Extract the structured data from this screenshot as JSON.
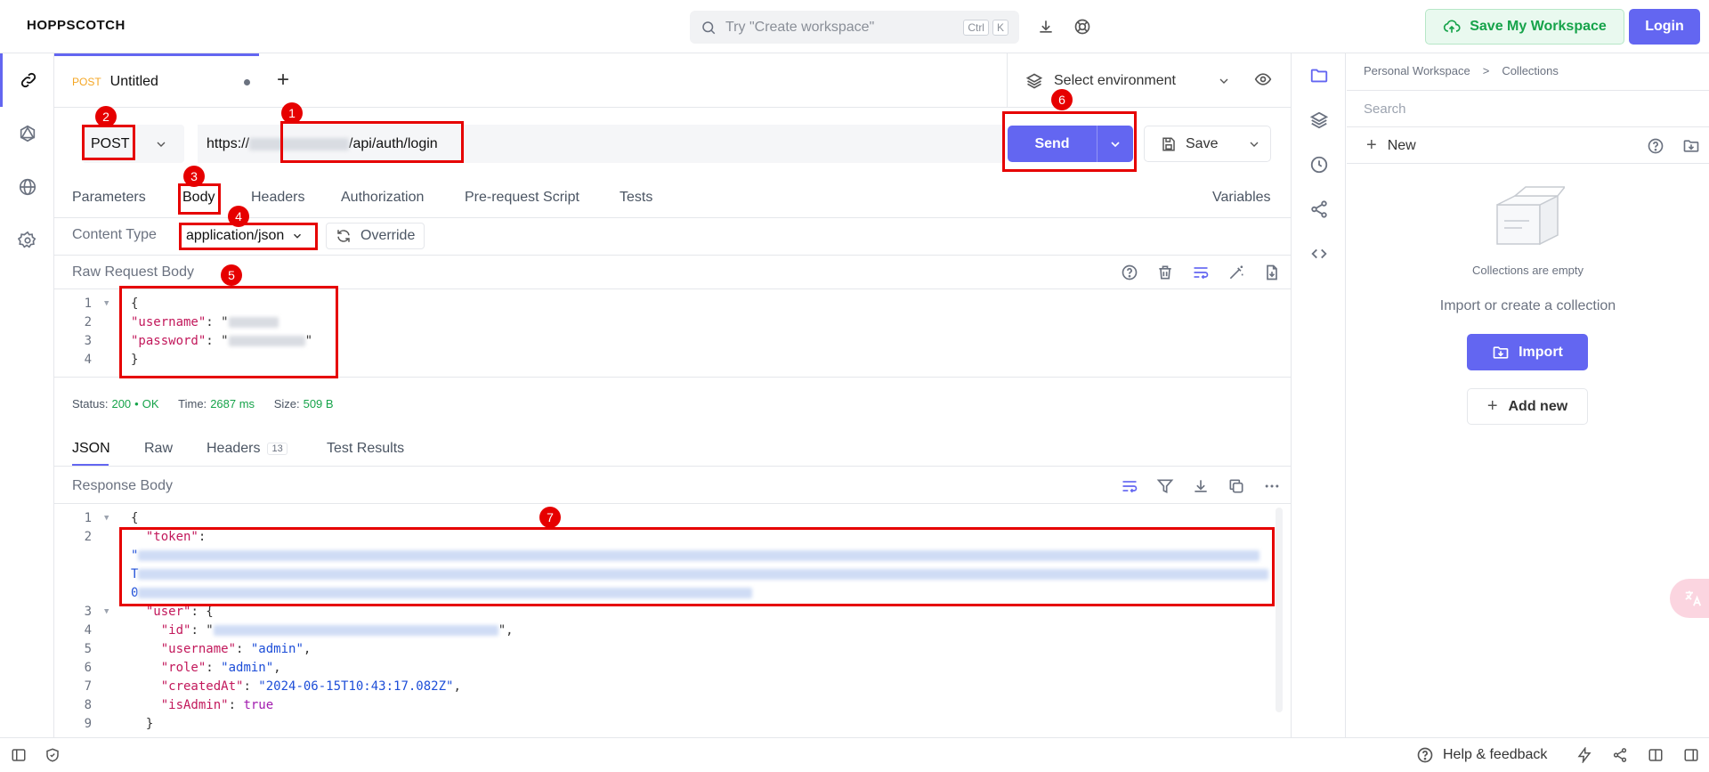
{
  "header": {
    "logo": "HOPPSCOTCH",
    "search_placeholder": "Try \"Create workspace\"",
    "kbd_ctrl": "Ctrl",
    "kbd_k": "K",
    "save_workspace_label": "Save My Workspace",
    "login_label": "Login"
  },
  "tab": {
    "method": "POST",
    "name": "Untitled",
    "add_label": "+"
  },
  "environment": {
    "label": "Select environment"
  },
  "request": {
    "method": "POST",
    "url_prefix": "https://",
    "url_suffix": "/api/auth/login",
    "send_label": "Send",
    "save_label": "Save"
  },
  "request_tabs": [
    "Parameters",
    "Body",
    "Headers",
    "Authorization",
    "Pre-request Script",
    "Tests"
  ],
  "variables_label": "Variables",
  "content_type": {
    "label": "Content Type",
    "value": "application/json",
    "override_label": "Override"
  },
  "raw_body": {
    "label": "Raw Request Body",
    "lines": [
      {
        "n": "1",
        "text": "{"
      },
      {
        "n": "2",
        "key": "\"username\"",
        "colon": ": \"",
        "blurred": true
      },
      {
        "n": "3",
        "key": "\"password\"",
        "colon": ": \"",
        "blurred": true,
        "tail": "\""
      },
      {
        "n": "4",
        "text": "}"
      }
    ]
  },
  "status": {
    "status_label": "Status:",
    "status_code": "200",
    "status_dot": "•",
    "status_text": "OK",
    "time_label": "Time:",
    "time_value": "2687 ms",
    "size_label": "Size:",
    "size_value": "509 B"
  },
  "response_tabs": {
    "json": "JSON",
    "raw": "Raw",
    "headers": "Headers",
    "headers_count": "13",
    "test_results": "Test Results"
  },
  "response_body": {
    "label": "Response Body",
    "lines": [
      {
        "n": "1",
        "text": "{"
      },
      {
        "n": "2",
        "key": "\"token\"",
        "colon": ":"
      },
      {
        "n": "",
        "text": "\"",
        "blurred": true
      },
      {
        "n": "",
        "text": "T",
        "blurred": true
      },
      {
        "n": "",
        "text": "0",
        "blurred": true
      },
      {
        "n": "3",
        "key": "\"user\"",
        "colon": ": {"
      },
      {
        "n": "4",
        "key": "\"id\"",
        "colon": ": \"",
        "blurred": true,
        "tail": "\","
      },
      {
        "n": "5",
        "key": "\"username\"",
        "colon": ": ",
        "value": "\"admin\"",
        "tail": ","
      },
      {
        "n": "6",
        "key": "\"role\"",
        "colon": ": ",
        "value": "\"admin\"",
        "tail": ","
      },
      {
        "n": "7",
        "key": "\"createdAt\"",
        "colon": ": ",
        "value": "\"2024-06-15T10:43:17.082Z\"",
        "tail": ","
      },
      {
        "n": "8",
        "key": "\"isAdmin\"",
        "colon": ": ",
        "bool": "true"
      },
      {
        "n": "9",
        "text": "}"
      }
    ]
  },
  "annotations": [
    "1",
    "2",
    "3",
    "4",
    "5",
    "6",
    "7"
  ],
  "collections": {
    "breadcrumb_1": "Personal Workspace",
    "breadcrumb_sep": ">",
    "breadcrumb_2": "Collections",
    "search_placeholder": "Search",
    "new_label": "New",
    "empty_title": "Collections are empty",
    "empty_sub": "Import or create a collection",
    "import_label": "Import",
    "add_new_label": "Add new"
  },
  "footer": {
    "help_label": "Help & feedback"
  },
  "colors": {
    "accent": "#6366f1",
    "success": "#16a34a",
    "annotation": "#e60000",
    "method_post": "#f5a623"
  }
}
